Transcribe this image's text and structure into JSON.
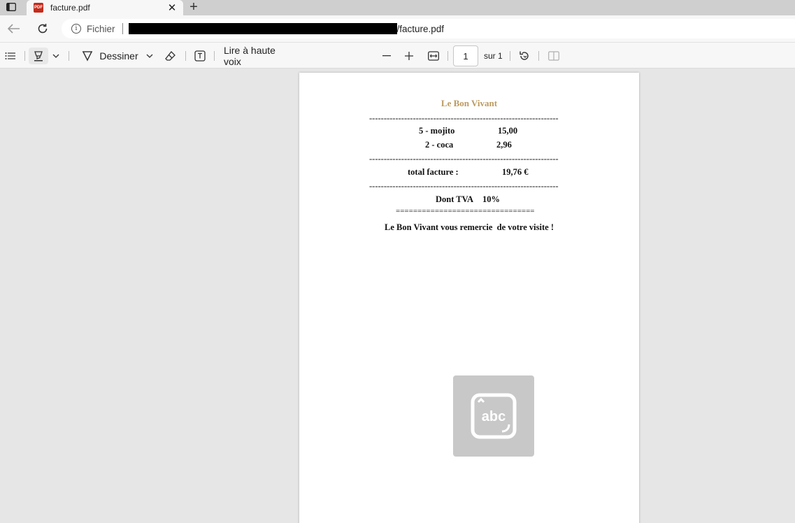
{
  "browser": {
    "tab_title": "facture.pdf",
    "tab_icon": "pdf-icon",
    "address": {
      "scheme_label": "Fichier",
      "path_suffix": "/facture.pdf"
    }
  },
  "pdf_toolbar": {
    "draw_label": "Dessiner",
    "read_aloud_label": "Lire à haute voix",
    "page_number": "1",
    "page_count_label": "sur 1"
  },
  "document": {
    "header": "Le Bon Vivant",
    "divider": "-----------------------------------------------------------------",
    "items": [
      {
        "label": "5 - mojito",
        "amount": "15,00"
      },
      {
        "label": "2 - coca",
        "amount": "2,96"
      }
    ],
    "total_label": "total facture :",
    "total_value": "19,76 €",
    "tva_label": "Dont TVA",
    "tva_value": "10%",
    "double_divider": "================================",
    "thanks": "Le Bon Vivant vous remercie  de votre visite !"
  },
  "overlay": {
    "icon_text": "abc"
  },
  "colors": {
    "brand": "#bd9a5e",
    "pdf_red": "#c42b1c"
  }
}
